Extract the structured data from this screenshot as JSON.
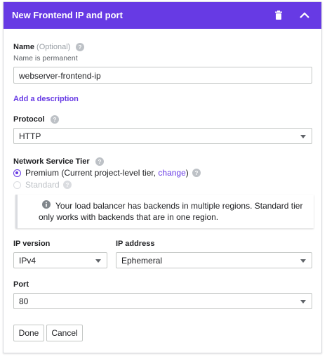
{
  "header": {
    "title": "New Frontend IP and port",
    "delete_icon": "trash-icon",
    "collapse_icon": "chevron-up-icon"
  },
  "name": {
    "label": "Name",
    "optional": "(Optional)",
    "hint": "Name is permanent",
    "value": "webserver-frontend-ip"
  },
  "description_link": "Add a description",
  "protocol": {
    "label": "Protocol",
    "value": "HTTP"
  },
  "network_tier": {
    "label": "Network Service Tier",
    "premium_prefix": "Premium (Current project-level tier, ",
    "premium_link": "change",
    "premium_suffix": ")",
    "standard": "Standard",
    "selected": "Premium"
  },
  "info": {
    "icon": "info-icon",
    "text": "Your load balancer has backends in multiple regions. Standard tier only works with backends that are in one region."
  },
  "ip_version": {
    "label": "IP version",
    "value": "IPv4"
  },
  "ip_address": {
    "label": "IP address",
    "value": "Ephemeral"
  },
  "port": {
    "label": "Port",
    "value": "80"
  },
  "buttons": {
    "done": "Done",
    "cancel": "Cancel"
  },
  "colors": {
    "accent": "#673ae4",
    "header_text": "#ffffff",
    "border": "#c4c7c5"
  }
}
